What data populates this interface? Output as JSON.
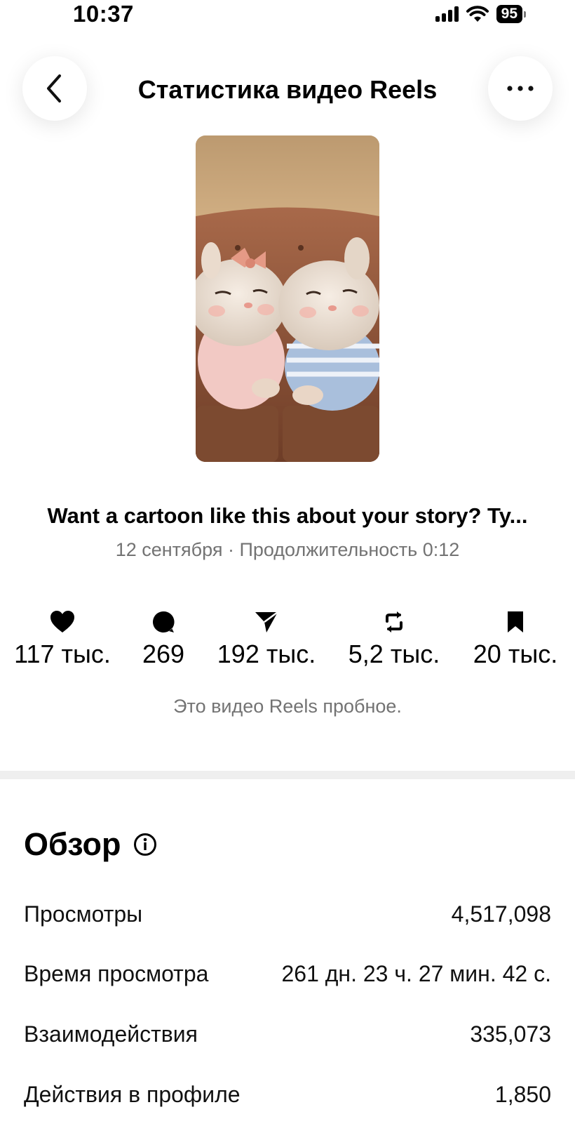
{
  "status_bar": {
    "time": "10:37",
    "battery": "95",
    "icons": [
      "signal-icon",
      "wifi-icon",
      "battery-icon"
    ]
  },
  "header": {
    "title": "Статистика видео Reels",
    "back_icon": "chevron-left-icon",
    "more_icon": "more-horizontal-icon"
  },
  "post": {
    "caption": "Want a cartoon like this about your story? Ty...",
    "meta": "12 сентября · Продолжительность 0:12",
    "thumbnail": "two-cartoon-bunnies-on-sofa"
  },
  "stats": [
    {
      "icon": "heart-icon",
      "value": "117 тыс."
    },
    {
      "icon": "comment-icon",
      "value": "269"
    },
    {
      "icon": "send-icon",
      "value": "192 тыс."
    },
    {
      "icon": "repost-icon",
      "value": "5,2 тыс."
    },
    {
      "icon": "bookmark-icon",
      "value": "20 тыс."
    }
  ],
  "note": "Это видео Reels пробное.",
  "overview": {
    "title": "Обзор",
    "info_icon": "info-icon",
    "rows": [
      {
        "label": "Просмотры",
        "value": "4,517,098"
      },
      {
        "label": "Время просмотра",
        "value": "261 дн. 23 ч. 27 мин. 42 с."
      },
      {
        "label": "Взаимодействия",
        "value": "335,073"
      },
      {
        "label": "Действия в профиле",
        "value": "1,850"
      }
    ]
  },
  "colors": {
    "secondary_text": "#737373",
    "divider": "#efefef",
    "background": "#ffffff"
  }
}
